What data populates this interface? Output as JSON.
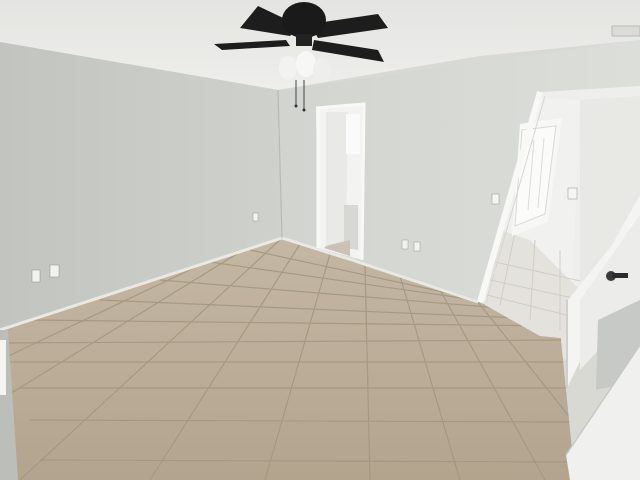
{
  "scene": {
    "kind": "photo",
    "subject": "empty-bedroom",
    "colors": {
      "ceiling": "#e9e9e6",
      "wall_left": "#c9cbc6",
      "wall_back": "#d8dad6",
      "wall_right": "#dedfdb",
      "floor_tile": "#b9ab97",
      "grout": "#9e927f",
      "door_white": "#f2f2f0",
      "fan_dark": "#1d1d1d",
      "hall_floor": "#e4e2dd"
    },
    "elements": [
      "ceiling",
      "ceiling-fan",
      "left-wall",
      "back-wall",
      "right-wall",
      "tile-floor",
      "bathroom-doorway",
      "hallway-doorway",
      "open-door",
      "hallway-door",
      "electrical-outlets",
      "light-switches",
      "baseboards"
    ]
  }
}
